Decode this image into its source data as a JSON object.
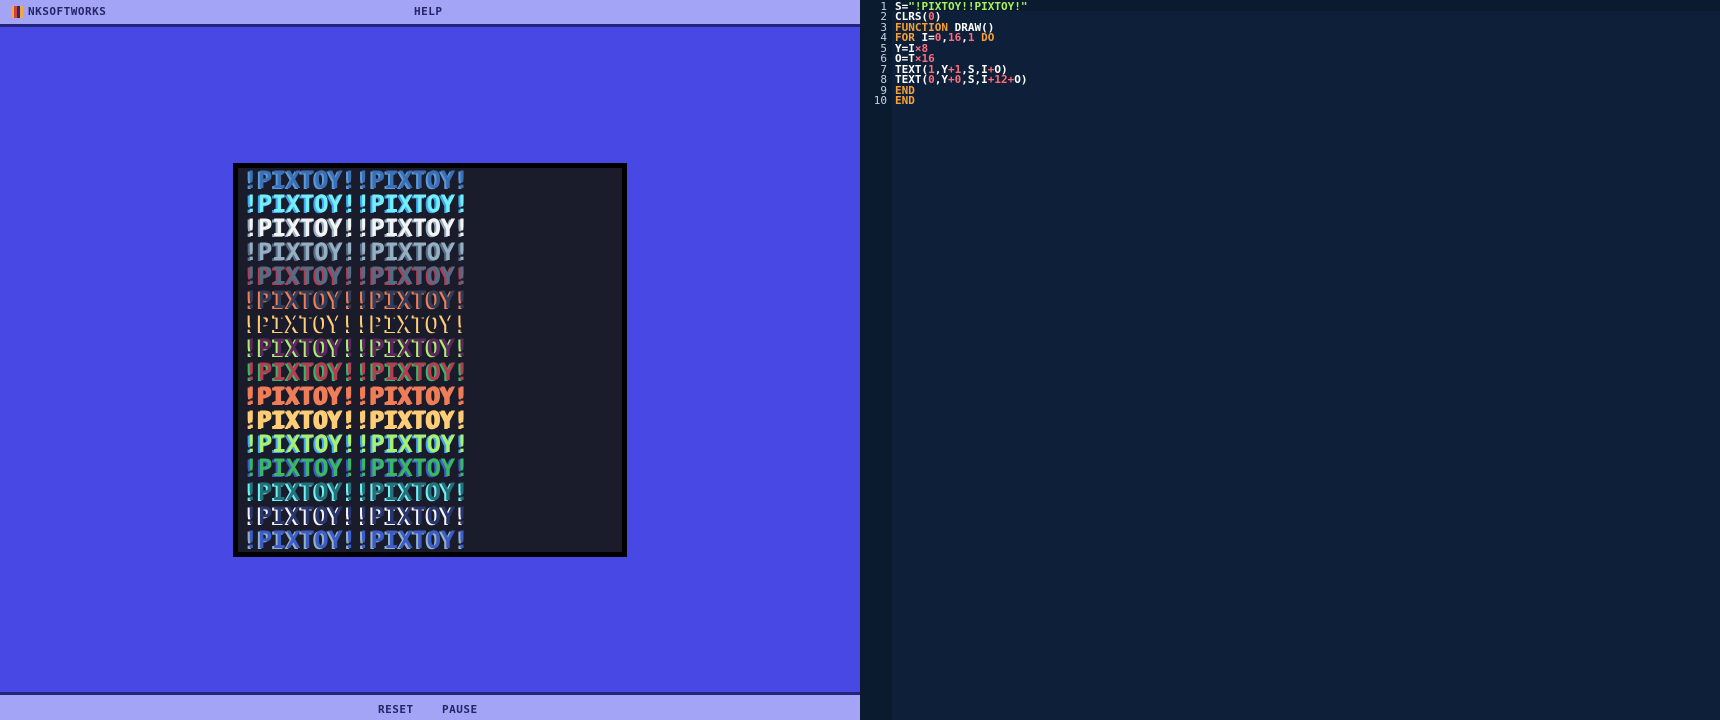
{
  "app": {
    "brand": "NKSOFTWORKS",
    "help_label": "HELP",
    "logo_colors": [
      "#f2a93b",
      "#d43f3f",
      "#2a2a7a",
      "#f2a93b"
    ]
  },
  "controls": {
    "reset_label": "RESET",
    "pause_label": "PAUSE"
  },
  "screen": {
    "text": "!PIXTOY!!PIXTOY!",
    "rows": [
      {
        "color": "#3b6fb6",
        "shadow": "#5a9ad6"
      },
      {
        "color": "#73eff7",
        "shadow": "#41a6f6"
      },
      {
        "color": "#f4f4f4",
        "shadow": "#94b0c2"
      },
      {
        "color": "#94b0c2",
        "shadow": "#566c86"
      },
      {
        "color": "#566c86",
        "shadow": "#b13e53"
      },
      {
        "color": "#333c57",
        "shadow": "#ef7d57"
      },
      {
        "color": "#1a1c2c",
        "shadow": "#ffcd75"
      },
      {
        "color": "#5d275d",
        "shadow": "#a7f070"
      },
      {
        "color": "#b13e53",
        "shadow": "#38b764"
      },
      {
        "color": "#ef7d57",
        "shadow": "#ef7d57"
      },
      {
        "color": "#ffcd75",
        "shadow": "#ffcd75"
      },
      {
        "color": "#a7f070",
        "shadow": "#41a6f6"
      },
      {
        "color": "#38b764",
        "shadow": "#3b5dc9"
      },
      {
        "color": "#257179",
        "shadow": "#73eff7"
      },
      {
        "color": "#29366f",
        "shadow": "#f4f4f4"
      },
      {
        "color": "#3b5dc9",
        "shadow": "#94b0c2"
      }
    ]
  },
  "editor": {
    "line_numbers": [
      "1",
      "2",
      "3",
      "4",
      "5",
      "6",
      "7",
      "8",
      "9",
      "10"
    ],
    "lines": [
      [
        {
          "t": "S=",
          "c": "w"
        },
        {
          "t": "\"!PIXTOY!!PIXTOY!\"",
          "c": "s"
        }
      ],
      [
        {
          "t": "CLRS(",
          "c": "w"
        },
        {
          "t": "0",
          "c": "n"
        },
        {
          "t": ")",
          "c": "w"
        }
      ],
      [
        {
          "t": "FUNCTION",
          "c": "k"
        },
        {
          "t": " DRAW()",
          "c": "w"
        }
      ],
      [
        {
          "t": "FOR",
          "c": "k"
        },
        {
          "t": " I=",
          "c": "w"
        },
        {
          "t": "0",
          "c": "n"
        },
        {
          "t": ",",
          "c": "w"
        },
        {
          "t": "16",
          "c": "n"
        },
        {
          "t": ",",
          "c": "w"
        },
        {
          "t": "1",
          "c": "n"
        },
        {
          "t": " DO",
          "c": "k"
        }
      ],
      [
        {
          "t": "Y=I",
          "c": "w"
        },
        {
          "t": "×8",
          "c": "n"
        }
      ],
      [
        {
          "t": "O=T",
          "c": "w"
        },
        {
          "t": "×16",
          "c": "n"
        }
      ],
      [
        {
          "t": "TEXT(",
          "c": "w"
        },
        {
          "t": "1",
          "c": "n"
        },
        {
          "t": ",Y",
          "c": "w"
        },
        {
          "t": "+1",
          "c": "n"
        },
        {
          "t": ",S,I",
          "c": "w"
        },
        {
          "t": "+",
          "c": "n"
        },
        {
          "t": "O)",
          "c": "w"
        }
      ],
      [
        {
          "t": "TEXT(",
          "c": "w"
        },
        {
          "t": "0",
          "c": "n"
        },
        {
          "t": ",Y",
          "c": "w"
        },
        {
          "t": "+0",
          "c": "n"
        },
        {
          "t": ",S,I",
          "c": "w"
        },
        {
          "t": "+12+",
          "c": "n"
        },
        {
          "t": "O)",
          "c": "w"
        }
      ],
      [
        {
          "t": "END",
          "c": "k"
        }
      ],
      [
        {
          "t": "END",
          "c": "k"
        }
      ]
    ]
  }
}
